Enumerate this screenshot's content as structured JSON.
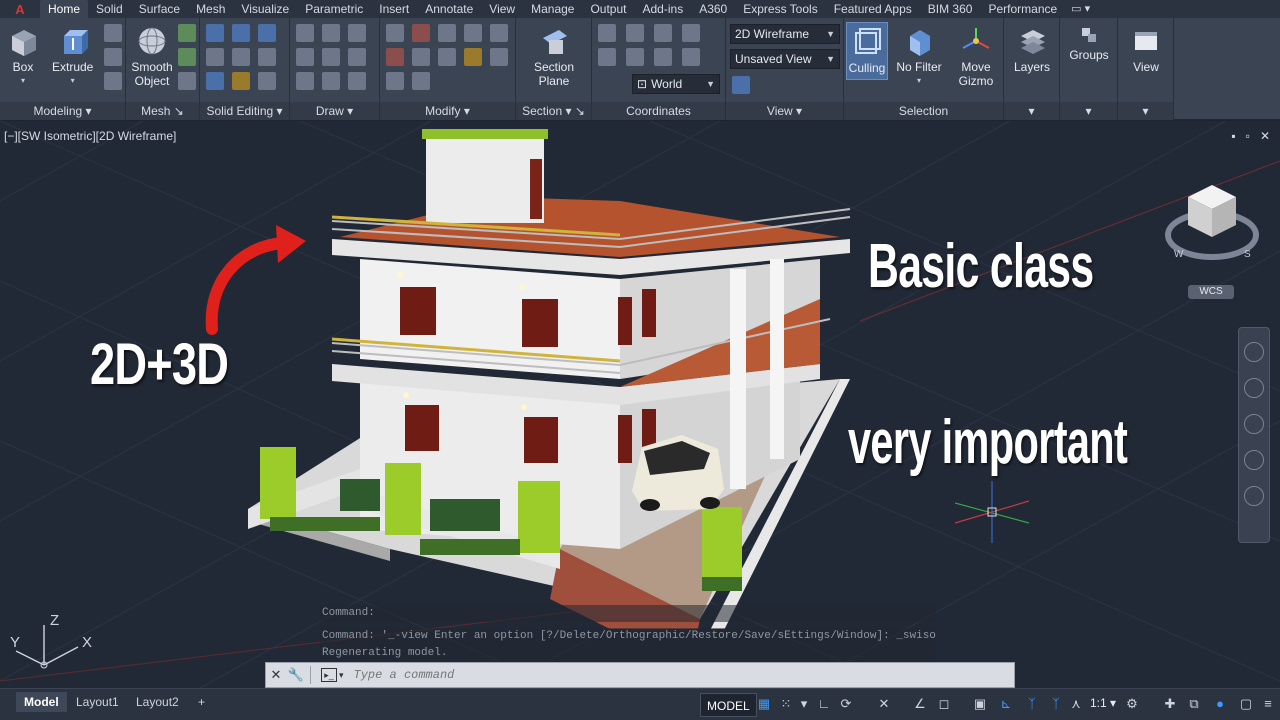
{
  "ribbon_tabs": [
    "Home",
    "Solid",
    "Surface",
    "Mesh",
    "Visualize",
    "Parametric",
    "Insert",
    "Annotate",
    "View",
    "Manage",
    "Output",
    "Add-ins",
    "A360",
    "Express Tools",
    "Featured Apps",
    "BIM 360",
    "Performance"
  ],
  "active_tab": "Home",
  "panels": {
    "modeling": {
      "label": "Modeling",
      "box": "Box",
      "extrude": "Extrude"
    },
    "mesh": {
      "label": "Mesh",
      "smooth_object": "Smooth Object"
    },
    "solid_editing": {
      "label": "Solid Editing"
    },
    "draw": {
      "label": "Draw"
    },
    "modify": {
      "label": "Modify"
    },
    "section": {
      "label": "Section",
      "section_plane": "Section Plane"
    },
    "coordinates": {
      "label": "Coordinates",
      "ucs_value": "World"
    },
    "view": {
      "label": "View",
      "visual_style": "2D Wireframe",
      "named_view": "Unsaved View"
    },
    "selection": {
      "label": "Selection",
      "culling": "Culling",
      "no_filter": "No Filter",
      "move_gizmo": "Move Gizmo"
    },
    "layers": {
      "label": "Layers"
    },
    "groups": {
      "label": "Groups"
    },
    "view2": {
      "label": "View"
    }
  },
  "viewport": {
    "label": "[−][SW Isometric][2D Wireframe]",
    "window_controls": [
      "▪",
      "▫",
      "✕"
    ],
    "viewcube_wcs": "WCS",
    "overlay": {
      "left_text": "2D+3D",
      "top_right_text": "Basic class",
      "right_text": "very important"
    }
  },
  "command_history": [
    "Command:",
    "Command: '_-view Enter an option [?/Delete/Orthographic/Restore/Save/sEttings/Window]: _swiso",
    "Regenerating model."
  ],
  "command_placeholder": "Type a command",
  "layout_tabs": [
    "Model",
    "Layout1",
    "Layout2"
  ],
  "add_layout": "+",
  "status": {
    "model": "MODEL",
    "scale": "1:1"
  },
  "colors": {
    "background": "#222936",
    "ribbon": "#3b4453",
    "accent_blue": "#3c9bff"
  }
}
